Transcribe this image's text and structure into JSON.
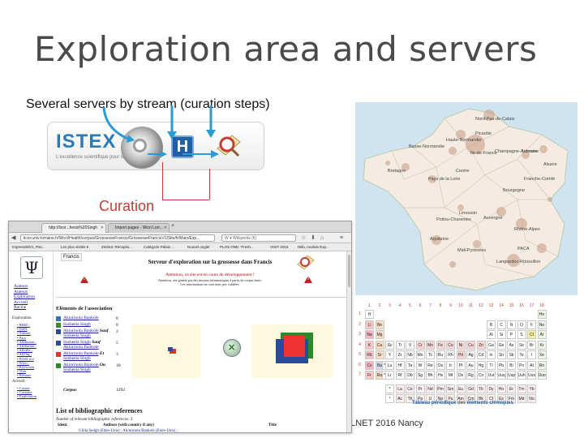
{
  "slide": {
    "title": "Exploration area and servers",
    "subtitle": "Several servers by stream (curation steps)",
    "footer": "LLNET 2016 Nancy"
  },
  "pipeline": {
    "logo": "ISTEX",
    "logo_tagline": "L'excellence scientifique pour tous",
    "curation_label": "Curation",
    "hal_letter": "H"
  },
  "map": {
    "regions": [
      "Nord-Pas-de-Calais",
      "Haute-Normandie",
      "Basse-Normandie",
      "Picardie",
      "Ile-de-France",
      "Champagne-Ardenne",
      "Lorraine",
      "Alsace",
      "Bretagne",
      "Pays de la Loire",
      "Centre",
      "Bourgogne",
      "Franche-Comté",
      "Poitou-Charentes",
      "Limousin",
      "Auvergne",
      "Rhône-Alpes",
      "Aquitaine",
      "Midi-Pyrénées",
      "PACA",
      "Languedoc-Roussillon"
    ]
  },
  "periodic": {
    "caption_prefix": "Tableau périodique",
    "caption_mid": "des",
    "caption_suffix": "éléments chimiques",
    "group_numbers": [
      "1",
      "2",
      "3",
      "4",
      "5",
      "6",
      "7",
      "8",
      "9",
      "10",
      "11",
      "12",
      "13",
      "14",
      "15",
      "16",
      "17",
      "18"
    ],
    "period_numbers": [
      "1",
      "2",
      "3",
      "4",
      "5",
      "6",
      "7"
    ],
    "rows": [
      [
        "H",
        "",
        "",
        "",
        "",
        "",
        "",
        "",
        "",
        "",
        "",
        "",
        "",
        "",
        "",
        "",
        "",
        "He"
      ],
      [
        "Li",
        "Be",
        "",
        "",
        "",
        "",
        "",
        "",
        "",
        "",
        "",
        "",
        "B",
        "C",
        "N",
        "O",
        "F",
        "Ne"
      ],
      [
        "Na",
        "Mg",
        "",
        "",
        "",
        "",
        "",
        "",
        "",
        "",
        "",
        "",
        "Al",
        "Si",
        "P",
        "S",
        "Cl",
        "Ar"
      ],
      [
        "K",
        "Ca",
        "Sc",
        "Ti",
        "V",
        "Cr",
        "Mn",
        "Fe",
        "Co",
        "Ni",
        "Cu",
        "Zn",
        "Ga",
        "Ge",
        "As",
        "Se",
        "Br",
        "Kr"
      ],
      [
        "Rb",
        "Sr",
        "Y",
        "Zr",
        "Nb",
        "Mo",
        "Tc",
        "Ru",
        "Rh",
        "Pd",
        "Ag",
        "Cd",
        "In",
        "Sn",
        "Sb",
        "Te",
        "I",
        "Xe"
      ],
      [
        "Cs",
        "Ba",
        "*",
        "Lu",
        "Hf",
        "Ta",
        "W",
        "Re",
        "Os",
        "Ir",
        "Pt",
        "Au",
        "Hg",
        "Tl",
        "Pb",
        "Bi",
        "Po",
        "At",
        "Rn"
      ],
      [
        "Fr",
        "Ra",
        "*",
        "Lr",
        "Rf",
        "Db",
        "Sg",
        "Bh",
        "Hs",
        "Mt",
        "Ds",
        "Rg",
        "Cn",
        "Uut",
        "Uuq",
        "Uup",
        "Uuh",
        "Uus",
        "Uuo"
      ]
    ],
    "lanthanides": [
      "*",
      "La",
      "Ce",
      "Pr",
      "Nd",
      "Pm",
      "Sm",
      "Eu",
      "Gd",
      "Tb",
      "Dy",
      "Ho",
      "Er",
      "Tm",
      "Yb"
    ],
    "actinides": [
      "*",
      "Ac",
      "Th",
      "Pa",
      "U",
      "Np",
      "Pu",
      "Am",
      "Cm",
      "Bk",
      "Cf",
      "Es",
      "Fm",
      "Md",
      "No"
    ]
  },
  "browser": {
    "tabs": [
      {
        "label": "http://licor...hesis%20Singh"
      },
      {
        "label": "Import pages - Wicri Lorr..."
      }
    ],
    "url": "licor.univ-lorraine.fr/Wicri/Health/corpus/GrossesseFrancis/GrossesseFrancisV1/Site/fr/Main/Exp...",
    "search_placeholder": "W ▾ Wikipédia (fr)",
    "bookmarks": [
      "Impress/MV1, Pas...",
      "Les plus visités ▾",
      "Zimbra: Réceptio...",
      "Catégorie Palais ...",
      "Nouvel onglet",
      "PLOS ONE: 'Fresh...",
      "VISIT 2015",
      "Dilib, module Exp..."
    ],
    "page": {
      "francis_label": "Francis",
      "header": "Serveur d'exploration sur la grossesse dans Francis",
      "attention": "Attention, ce site est en cours de développement !",
      "attention_note": "Attention, site généré par des moyens informatiques à partir de corpus bruts.",
      "attention_note2": "Les informations ne sont donc pas validées.",
      "side_links": [
        "Auteurs",
        "Auteurs",
        "Exploration",
        "Accueil",
        "Racine"
      ],
      "exploration_heading": "Exploration",
      "exploration_links": [
        "RBID ;",
        "ISSN",
        "Auteurs",
        "Pays",
        "Affiliation ;",
        "Affiliation ;",
        "Affville ;",
        "AffOrg ;",
        "PDSS (fr)",
        "Wicri ;",
        "Keywords",
        "Titre",
        "Résumé"
      ],
      "accueil_heading": "Accueil",
      "accueil_links": [
        "Corpus",
        "Curation",
        "Exploration"
      ],
      "association_title": "Eléments de l'association",
      "association_rows": [
        {
          "name": "Akinrinola Bankole",
          "connector": "",
          "name2": "",
          "count": "8",
          "color": "#3a6fb8"
        },
        {
          "name": "Susheela Singh",
          "connector": "",
          "name2": "",
          "count": "8",
          "color": "#3a8a3a"
        },
        {
          "name": "Akinrinola Bankole",
          "connector": "Sauf",
          "name2": "Susheela Singh",
          "count": "2",
          "color": "#2a4a9a"
        },
        {
          "name": "Susheela Singh",
          "connector": "Sauf",
          "name2": "Akinrinola Bankole",
          "count": "5",
          "color": "#2a4a9a"
        },
        {
          "name": "Akinrinola Bankole",
          "connector": "Et",
          "name2": "Susheela Singh",
          "count": "3",
          "color": "#d33"
        },
        {
          "name": "Akinrinola Bankole",
          "connector": "Ou",
          "name2": "Susheela Singh",
          "count": "10",
          "color": "#2a8a2a"
        }
      ],
      "corpus_label": "Corpus",
      "corpus_count": "1292",
      "biblio_title": "List of bibliographic references",
      "nb_refs": "Number of relevant bibliographic references: 3.",
      "col_ident": "Ident.",
      "col_authors": "Authors (with country if any)",
      "col_title": "Title",
      "last_row": "Gilda Sedgh (Etats-Unis) ; Akinrinola Bankole (Etats-Unis) ;"
    }
  }
}
